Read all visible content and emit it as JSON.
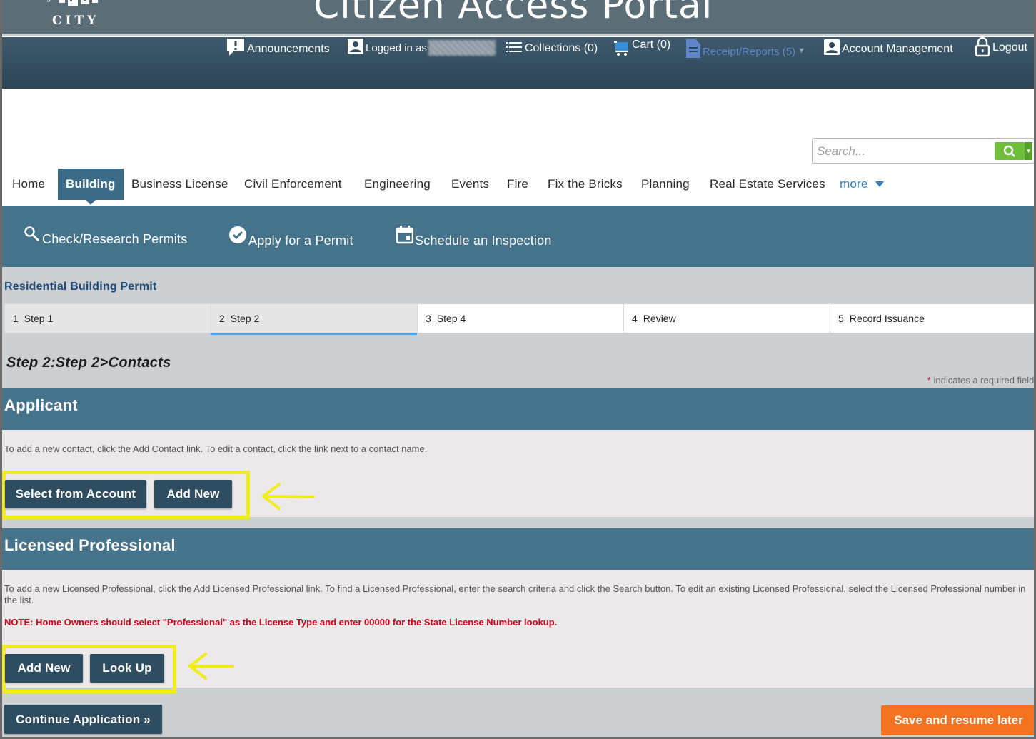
{
  "portal": {
    "title": "Citizen Access Portal",
    "logo_text": "CITY"
  },
  "topnav": {
    "announcements": "Announcements",
    "logged_in_as": "Logged in as",
    "collections": "Collections (0)",
    "cart": "Cart (0)",
    "receipts": "Receipt/Reports (5)",
    "account_management": "Account Management",
    "logout": "Logout"
  },
  "search": {
    "placeholder": "Search..."
  },
  "module_tabs": {
    "home": "Home",
    "building": "Building",
    "business_license": "Business License",
    "civil_enforcement": "Civil Enforcement",
    "engineering": "Engineering",
    "events": "Events",
    "fire": "Fire",
    "fix_the_bricks": "Fix the Bricks",
    "planning": "Planning",
    "real_estate_services": "Real Estate Services",
    "more": "more"
  },
  "subnav": {
    "check_research": "Check/Research Permits",
    "apply": "Apply for a Permit",
    "schedule": "Schedule an Inspection"
  },
  "permit_title": "Residential Building Permit",
  "steps": [
    {
      "num": "1",
      "label": "Step 1"
    },
    {
      "num": "2",
      "label": "Step 2"
    },
    {
      "num": "3",
      "label": "Step 4"
    },
    {
      "num": "4",
      "label": "Review"
    },
    {
      "num": "5",
      "label": "Record Issuance"
    }
  ],
  "step_heading": "Step 2:Step 2>Contacts",
  "required_note": {
    "star": "*",
    "text": "indicates a required field."
  },
  "applicant": {
    "title": "Applicant",
    "help": "To add a new contact, click the Add Contact link. To edit a contact, click the link next to a contact name.",
    "select_from_account": "Select from Account",
    "add_new": "Add New"
  },
  "licensed_professional": {
    "title": "Licensed Professional",
    "help": "To add a new Licensed Professional, click the Add Licensed Professional link. To find a Licensed Professional, enter the search criteria and click the Search button. To edit an existing Licensed Professional, select the Licensed Professional number in the list.",
    "note": "NOTE: Home Owners should select \"Professional\" as the License Type and enter 00000 for the State License Number lookup.",
    "add_new": "Add New",
    "look_up": "Look Up"
  },
  "actions": {
    "continue": "Continue Application »",
    "save_later": "Save and resume later"
  },
  "colors": {
    "banner": "#5b6e78",
    "topnav": "#2c4557",
    "subnav": "#46738c",
    "button": "#2f4d60",
    "highlight": "#f2ec1c",
    "save_button": "#f47321",
    "search_button": "#6fbf3c"
  }
}
